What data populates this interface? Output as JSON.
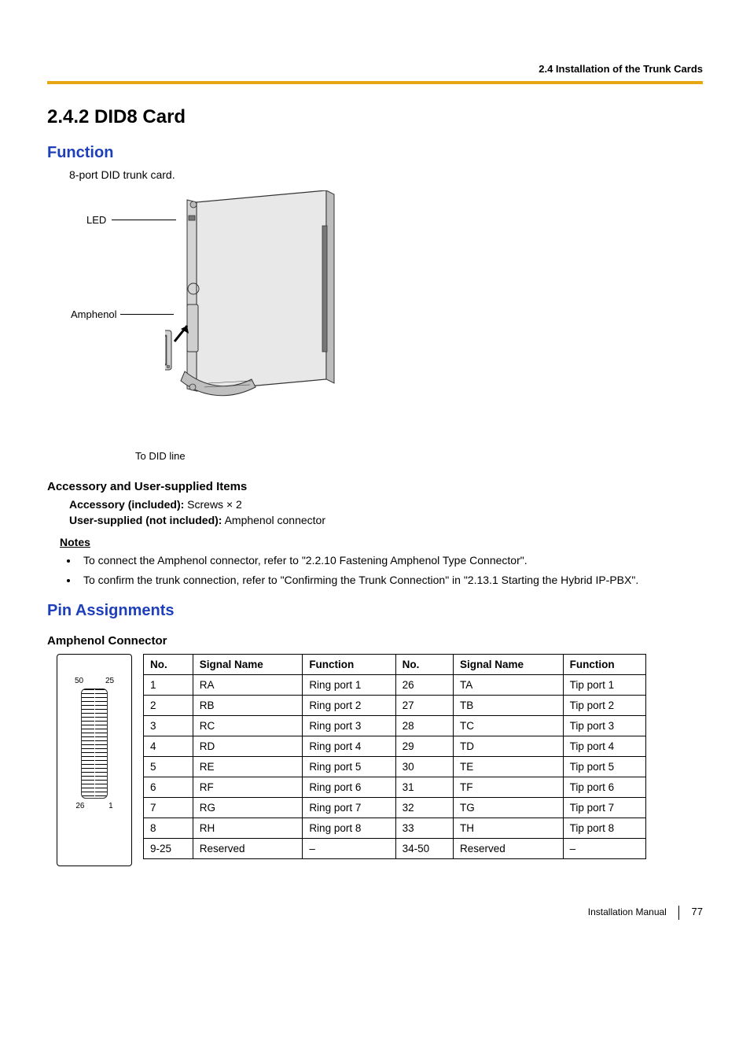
{
  "header": {
    "breadcrumb": "2.4 Installation of the Trunk Cards"
  },
  "section": {
    "number_title": "2.4.2   DID8 Card"
  },
  "function": {
    "heading": "Function",
    "desc": "8-port DID trunk card.",
    "labels": {
      "led": "LED",
      "amphenol": "Amphenol",
      "to_did_line": "To DID line"
    }
  },
  "accessory": {
    "heading": "Accessory and User-supplied Items",
    "acc_label": "Accessory (included):",
    "acc_value": " Screws × 2",
    "user_label": "User-supplied (not included):",
    "user_value": " Amphenol connector"
  },
  "notes": {
    "heading": "Notes",
    "items": [
      "To connect the Amphenol connector, refer to \"2.2.10 Fastening Amphenol Type Connector\".",
      "To confirm the trunk connection, refer to \"Confirming the Trunk Connection\" in \"2.13.1 Starting the Hybrid IP-PBX\"."
    ]
  },
  "pin": {
    "heading": "Pin Assignments",
    "subheading": "Amphenol Connector",
    "conn_labels": {
      "tl": "50",
      "tr": "25",
      "bl": "26",
      "br": "1"
    },
    "headers": [
      "No.",
      "Signal Name",
      "Function",
      "No.",
      "Signal Name",
      "Function"
    ],
    "rows": [
      [
        "1",
        "RA",
        "Ring port 1",
        "26",
        "TA",
        "Tip port 1"
      ],
      [
        "2",
        "RB",
        "Ring port 2",
        "27",
        "TB",
        "Tip port 2"
      ],
      [
        "3",
        "RC",
        "Ring port 3",
        "28",
        "TC",
        "Tip port 3"
      ],
      [
        "4",
        "RD",
        "Ring port 4",
        "29",
        "TD",
        "Tip port 4"
      ],
      [
        "5",
        "RE",
        "Ring port 5",
        "30",
        "TE",
        "Tip port 5"
      ],
      [
        "6",
        "RF",
        "Ring port 6",
        "31",
        "TF",
        "Tip port 6"
      ],
      [
        "7",
        "RG",
        "Ring port 7",
        "32",
        "TG",
        "Tip port 7"
      ],
      [
        "8",
        "RH",
        "Ring port 8",
        "33",
        "TH",
        "Tip port 8"
      ],
      [
        "9-25",
        "Reserved",
        "–",
        "34-50",
        "Reserved",
        "–"
      ]
    ]
  },
  "footer": {
    "manual": "Installation Manual",
    "page": "77"
  }
}
